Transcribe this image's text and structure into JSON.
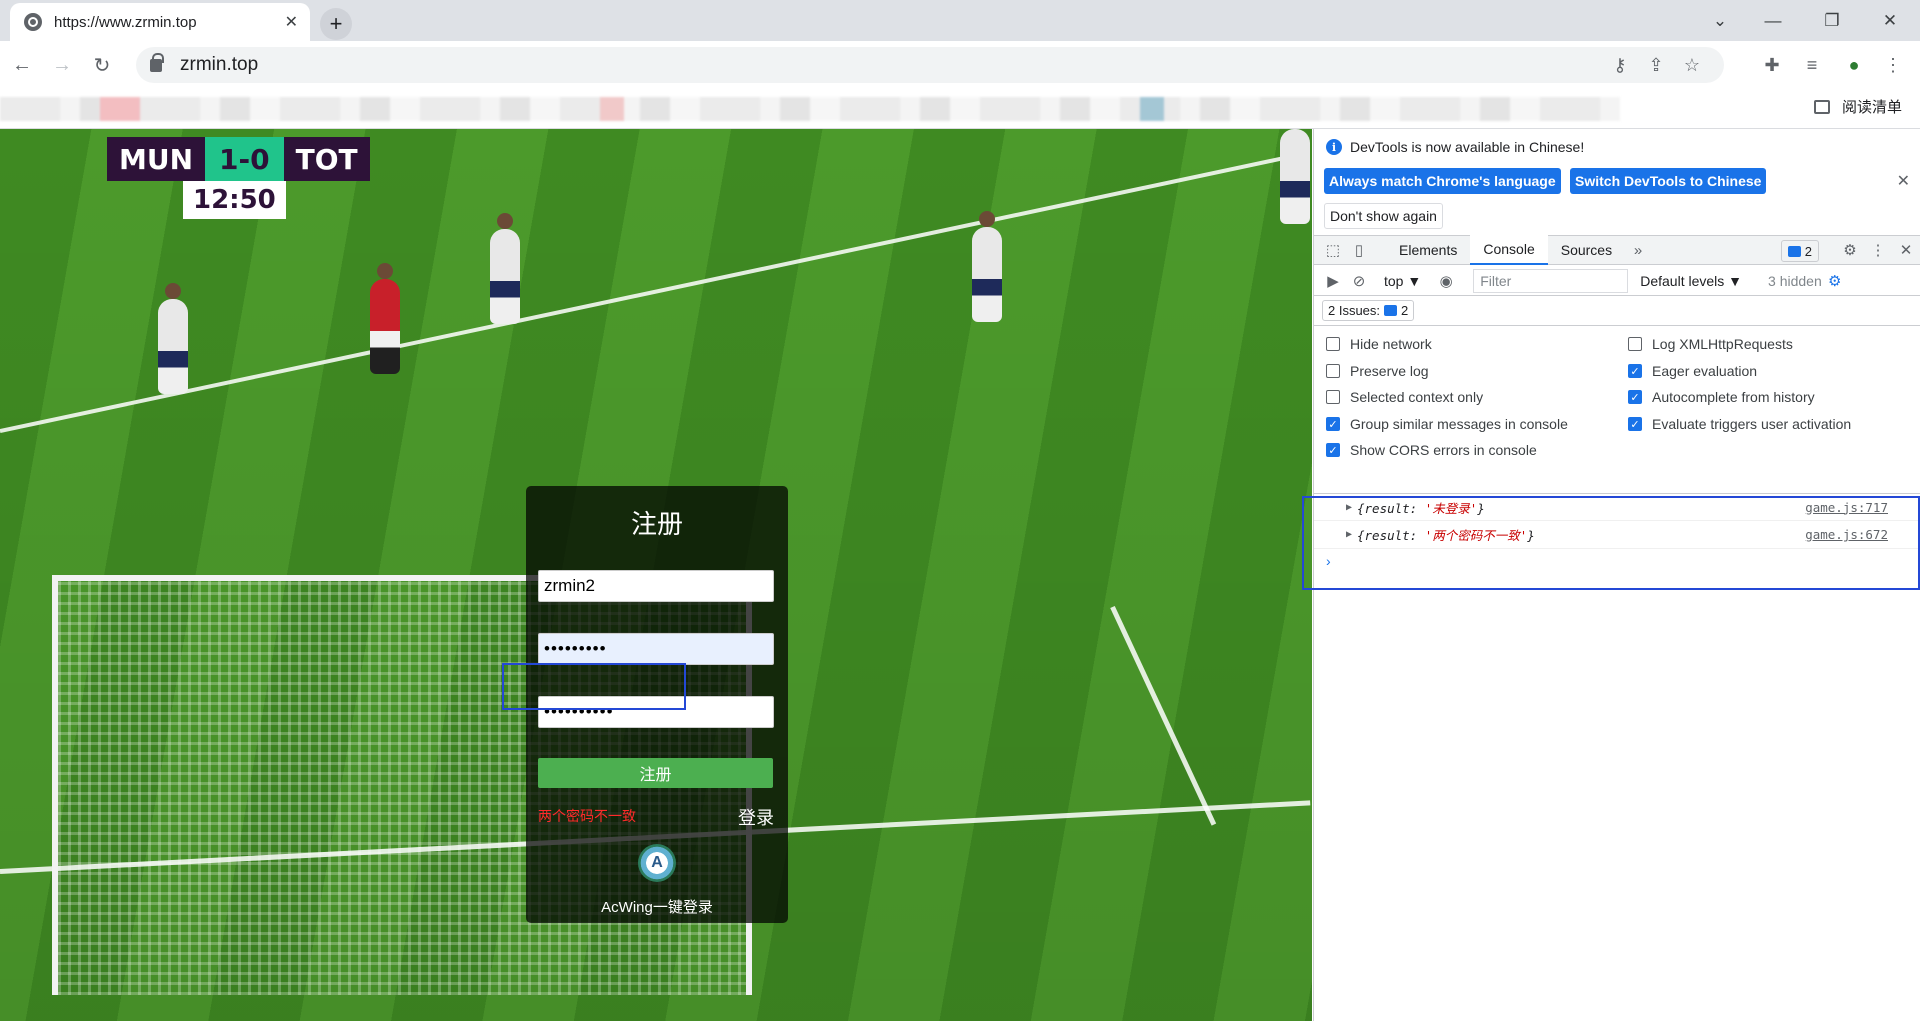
{
  "browser": {
    "tab_title": "https://www.zrmin.top",
    "tab_close": "✕",
    "new_tab": "+",
    "url": "zrmin.top",
    "reading_list": "阅读清单"
  },
  "game": {
    "scoreboard": {
      "home": "MUN",
      "score": "1-0",
      "away": "TOT",
      "clock": "12:50"
    },
    "register": {
      "title": "注册",
      "username_value": "zrmin2",
      "password_value": "•••••••••",
      "confirm_value": "••••••••••",
      "submit_label": "注册",
      "error_message": "两个密码不一致",
      "login_link": "登录",
      "acwing_label": "AcWing一键登录",
      "acwing_logo": "A"
    }
  },
  "devtools": {
    "info_message": "DevTools is now available in Chinese!",
    "btn_match": "Always match Chrome's language",
    "btn_switch": "Switch DevTools to Chinese",
    "btn_dont_show": "Don't show again",
    "tabs": [
      "Elements",
      "Console",
      "Sources"
    ],
    "more_tabs": "»",
    "issue_count": "2",
    "context": "top ▼",
    "filter_placeholder": "Filter",
    "levels": "Default levels ▼",
    "hidden": "3 hidden",
    "issues_label": "2 Issues:",
    "issues_count": "2",
    "settings": {
      "hide_network": "Hide network",
      "preserve_log": "Preserve log",
      "selected_context": "Selected context only",
      "group_similar": "Group similar messages in console",
      "show_cors": "Show CORS errors in console",
      "log_xhr": "Log XMLHttpRequests",
      "eager_eval": "Eager evaluation",
      "autocomplete": "Autocomplete from history",
      "eval_triggers": "Evaluate triggers user activation"
    },
    "logs": [
      {
        "prefix": "{result: ",
        "value": "'未登录'",
        "suffix": "}",
        "source": "game.js:717"
      },
      {
        "prefix": "{result: ",
        "value": "'两个密码不一致'",
        "suffix": "}",
        "source": "game.js:672"
      }
    ],
    "prompt": "›"
  }
}
